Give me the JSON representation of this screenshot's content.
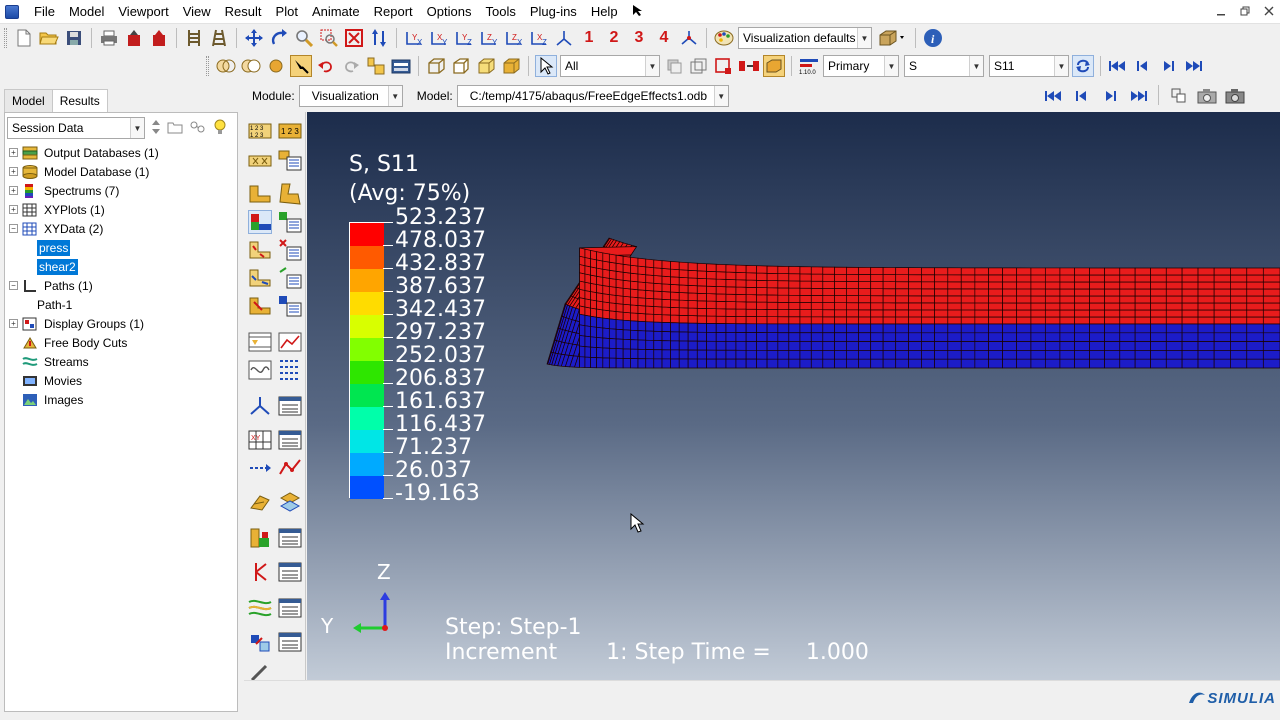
{
  "menu": [
    "File",
    "Model",
    "Viewport",
    "View",
    "Result",
    "Plot",
    "Animate",
    "Report",
    "Options",
    "Tools",
    "Plug-ins",
    "Help"
  ],
  "menu_help_icon": "whats-this-arrow",
  "toolbar1": {
    "step_numbers": [
      "1",
      "2",
      "3",
      "4"
    ],
    "vis_defaults": "Visualization defaults"
  },
  "toolbar2": {
    "selection": "All",
    "primary": "Primary",
    "variable": "S",
    "component": "S11"
  },
  "modulebar": {
    "module_label": "Module:",
    "module_value": "Visualization",
    "model_label": "Model:",
    "model_value": "C:/temp/4175/abaqus/FreeEdgeEffects1.odb"
  },
  "left": {
    "tabs": [
      "Model",
      "Results"
    ],
    "active_tab": "Results",
    "session": "Session Data",
    "tree": [
      {
        "label": "Output Databases (1)",
        "icon": "database-icon"
      },
      {
        "label": "Model Database (1)",
        "icon": "database-icon"
      },
      {
        "label": "Spectrums (7)",
        "icon": "spectrum-icon"
      },
      {
        "label": "XYPlots (1)",
        "icon": "grid-icon"
      },
      {
        "label": "XYData (2)",
        "icon": "grid-icon"
      },
      {
        "label": "press",
        "icon": ""
      },
      {
        "label": "shear2",
        "icon": ""
      },
      {
        "label": "Paths (1)",
        "icon": "path-icon"
      },
      {
        "label": "Path-1",
        "icon": ""
      },
      {
        "label": "Display Groups (1)",
        "icon": "display-group-icon"
      },
      {
        "label": "Free Body Cuts",
        "icon": "free-body-icon"
      },
      {
        "label": "Streams",
        "icon": "stream-icon"
      },
      {
        "label": "Movies",
        "icon": "movie-icon"
      },
      {
        "label": "Images",
        "icon": "image-icon"
      }
    ]
  },
  "viewport": {
    "legend_title_1": "S, S11",
    "legend_title_2": "(Avg: 75%)",
    "legend_values": [
      "523.237",
      "478.037",
      "432.837",
      "387.637",
      "342.437",
      "297.237",
      "252.037",
      "206.837",
      "161.637",
      "116.437",
      "71.237",
      "26.037",
      "-19.163"
    ],
    "legend_colors": [
      "#ff0000",
      "#ff5a00",
      "#ffa500",
      "#ffdc00",
      "#d8ff00",
      "#82ff00",
      "#2ee600",
      "#00e650",
      "#00ffaa",
      "#00e6e6",
      "#00aaff",
      "#0050ff",
      "#0000ff"
    ],
    "triad_z": "Z",
    "triad_y": "Y",
    "step_line_1": "Step: Step-1",
    "step_line_2": "Increment       1: Step Time =     1.000",
    "mesh_top_color": "#e81c1c",
    "mesh_bottom_color": "#1c1cc8"
  },
  "brand": "SIMULIA"
}
